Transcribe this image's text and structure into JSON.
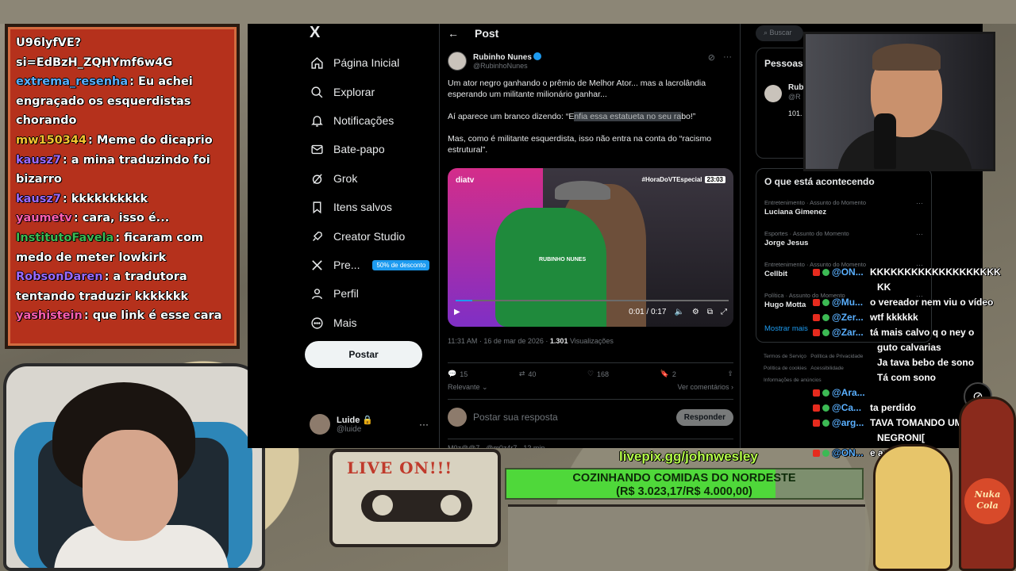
{
  "chat_left": [
    {
      "user": "",
      "user_color": "#ffffff",
      "text": "U96lyfVE?"
    },
    {
      "user": "",
      "user_color": "#ffffff",
      "text": "si=EdBzH_ZQHYmf6w4G"
    },
    {
      "user": "extrema_resenha",
      "user_color": "#5ab0ff",
      "text": ": Eu achei engraçado os esquerdistas chorando"
    },
    {
      "user": "mw150344",
      "user_color": "#f4c430",
      "text": ": Meme do dicaprio"
    },
    {
      "user": "kausz7",
      "user_color": "#9b6bff",
      "text": ": a mina traduzindo foi bizarro"
    },
    {
      "user": "kausz7",
      "user_color": "#9b6bff",
      "text": ": kkkkkkkkkk"
    },
    {
      "user": "yaumetv",
      "user_color": "#ff5fb0",
      "text": ": cara, isso é..."
    },
    {
      "user": "InstitutoFavela",
      "user_color": "#3cba54",
      "text": ": ficaram com medo de meter lowkirk"
    },
    {
      "user": "RobsonDaren",
      "user_color": "#9b6bff",
      "text": ": a tradutora tentando traduzir kkkkkkk"
    },
    {
      "user": "yashistein",
      "user_color": "#ff5fb0",
      "text": ": que link é esse cara"
    }
  ],
  "sidebar": {
    "logo": "X",
    "items": [
      {
        "label": "Página Inicial",
        "icon": "home-icon"
      },
      {
        "label": "Explorar",
        "icon": "search-icon"
      },
      {
        "label": "Notificações",
        "icon": "bell-icon"
      },
      {
        "label": "Bate-papo",
        "icon": "mail-icon"
      },
      {
        "label": "Grok",
        "icon": "grok-icon"
      },
      {
        "label": "Itens salvos",
        "icon": "bookmark-icon"
      },
      {
        "label": "Creator Studio",
        "icon": "rocket-icon"
      },
      {
        "label": "Pre...",
        "icon": "x-icon",
        "badge": "50% de desconto"
      },
      {
        "label": "Perfil",
        "icon": "person-icon"
      },
      {
        "label": "Mais",
        "icon": "more-circle-icon"
      }
    ],
    "post_button": "Postar",
    "user": {
      "name": "Luide",
      "handle": "@luide"
    }
  },
  "post": {
    "back": "←",
    "header": "Post",
    "author_name": "Rubinho Nunes",
    "author_handle": "@RubinhoNunes",
    "text_1": "Um ator negro ganhando o prêmio de Melhor Ator... mas a lacrolândia esperando um militante milionário ganhar...",
    "text_2_pre": "Aí aparece um branco dizendo: “E",
    "text_2_hl": "nfia essa estatueta no seu ra",
    "text_2_post": "bo!”",
    "text_3": "Mas, como é militante esquerdista, isso não entra na conta do “racismo estrutural”.",
    "video": {
      "logo": "diatv",
      "tag": "#HoraDoVTEspecial",
      "duration": "23:03",
      "watermark": "RUBINHO NUNES",
      "time": "0:01 / 0:17",
      "progress": 0.06
    },
    "timestamp": "11:31 AM · 16 de mar de 2026 · ",
    "views_count": "1.301",
    "views_label": " Visualizações",
    "stats": {
      "replies": "15",
      "reposts": "40",
      "likes": "168",
      "bookmarks": "2"
    },
    "sort_label": "Relevante ⌄",
    "see_comments": "Ver comentários ›",
    "reply_placeholder": "Postar sua resposta",
    "reply_button": "Responder",
    "next_tweet": "M0z@@7 · @m0z4r7 · 12 min"
  },
  "right_col": {
    "search_placeholder": "Buscar",
    "people_title": "Pessoas",
    "people_name": "Rub",
    "people_handle": "@R",
    "people_bio": "101. pan 551",
    "trends_title": "O que está acontecendo",
    "trends": [
      {
        "cat": "Entretenimento · Assunto do Momento",
        "name": "Luciana Gimenez"
      },
      {
        "cat": "Esportes · Assunto do Momento",
        "name": "Jorge Jesus"
      },
      {
        "cat": "Entretenimento · Assunto do Momento",
        "name": "Cellbit"
      },
      {
        "cat": "Política · Assunto do Momento",
        "name": "Hugo Motta"
      }
    ],
    "show_more": "Mostrar mais",
    "footer": [
      "Termos de Serviço",
      "Política de Privacidade",
      "Política de cookies",
      "Acessibilidade",
      "Informações de anúncios"
    ]
  },
  "chat_right": [
    {
      "user": "@ON...",
      "text": "KKKKKKKKKKKKKKKKKKK"
    },
    {
      "user": "",
      "text": "KK"
    },
    {
      "user": "@Mu...",
      "text": "o vereador nem viu o vídeo"
    },
    {
      "user": "@Zer...",
      "text": "wtf kkkkkk"
    },
    {
      "user": "@Zar...",
      "text": "tá mais calvo q o ney o"
    },
    {
      "user": "",
      "text": "guto calvarias"
    },
    {
      "user": "",
      "text": "Ja tava bebo de sono"
    },
    {
      "user": "",
      "text": "Tá com sono"
    },
    {
      "user": "@Ara...",
      "text": ""
    },
    {
      "user": "@Ca...",
      "text": "ta perdido"
    },
    {
      "user": "@arg...",
      "text": "TAVA TOMANDO UM"
    },
    {
      "user": "",
      "text": "NEGRONI["
    },
    {
      "user": "@ON...",
      "text": "e assistindo"
    }
  ],
  "stream": {
    "cassette_label": "LIVE ON!!!",
    "livepix_url": "livepix.gg/johnwesley",
    "goal_title": "COZINHANDO COMIDAS DO NORDESTE",
    "goal_amount": "(R$ 3.023,17/R$ 4.000,00)",
    "goal_progress": 0.756,
    "bottle_label": "Nuka Cola"
  },
  "colors": {
    "accent": "#1d9bf0",
    "chat_bg": "#b5311c",
    "goal_fill": "#4fd83a"
  }
}
